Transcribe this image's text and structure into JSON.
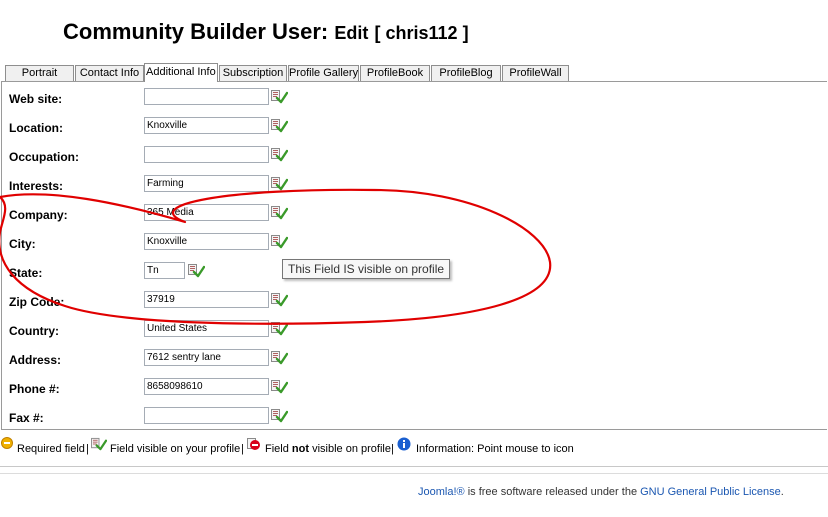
{
  "header": {
    "title": "Community Builder User:",
    "action": "Edit",
    "username": "[ chris112 ]"
  },
  "tabs": [
    {
      "label": "Portrait",
      "active": false
    },
    {
      "label": "Contact Info",
      "active": false
    },
    {
      "label": "Additional Info",
      "active": true
    },
    {
      "label": "Subscription",
      "active": false
    },
    {
      "label": "Profile Gallery",
      "active": false
    },
    {
      "label": "ProfileBook",
      "active": false
    },
    {
      "label": "ProfileBlog",
      "active": false
    },
    {
      "label": "ProfileWall",
      "active": false
    }
  ],
  "fields": [
    {
      "label": "Web site:",
      "value": ""
    },
    {
      "label": "Location:",
      "value": "Knoxville"
    },
    {
      "label": "Occupation:",
      "value": ""
    },
    {
      "label": "Interests:",
      "value": "Farming"
    },
    {
      "label": "Company:",
      "value": "365 Media"
    },
    {
      "label": "City:",
      "value": "Knoxville"
    },
    {
      "label": "State:",
      "value": "Tn"
    },
    {
      "label": "Zip Code:",
      "value": "37919"
    },
    {
      "label": "Country:",
      "value": "United States"
    },
    {
      "label": "Address:",
      "value": "7612 sentry lane"
    },
    {
      "label": "Phone #:",
      "value": "8658098610"
    },
    {
      "label": "Fax #:",
      "value": ""
    }
  ],
  "tooltip": "This Field IS visible on profile",
  "legend": {
    "required": "Required field",
    "sep": "|",
    "visible": "Field visible on your profile",
    "not_visible_pre": "Field",
    "not_visible_bold": "not",
    "not_visible_post": "visible on profile",
    "info": "Information: Point mouse to icon"
  },
  "footer": {
    "link1": "Joomla!®",
    "text": "is free software released under the",
    "link2": "GNU General Public License",
    "end": "."
  },
  "colors": {
    "annotation": "#e00000",
    "link": "#1b57b1",
    "required_icon": "#f0b000",
    "not_visible_icon": "#d8001a",
    "info_icon": "#1a5fd0"
  }
}
